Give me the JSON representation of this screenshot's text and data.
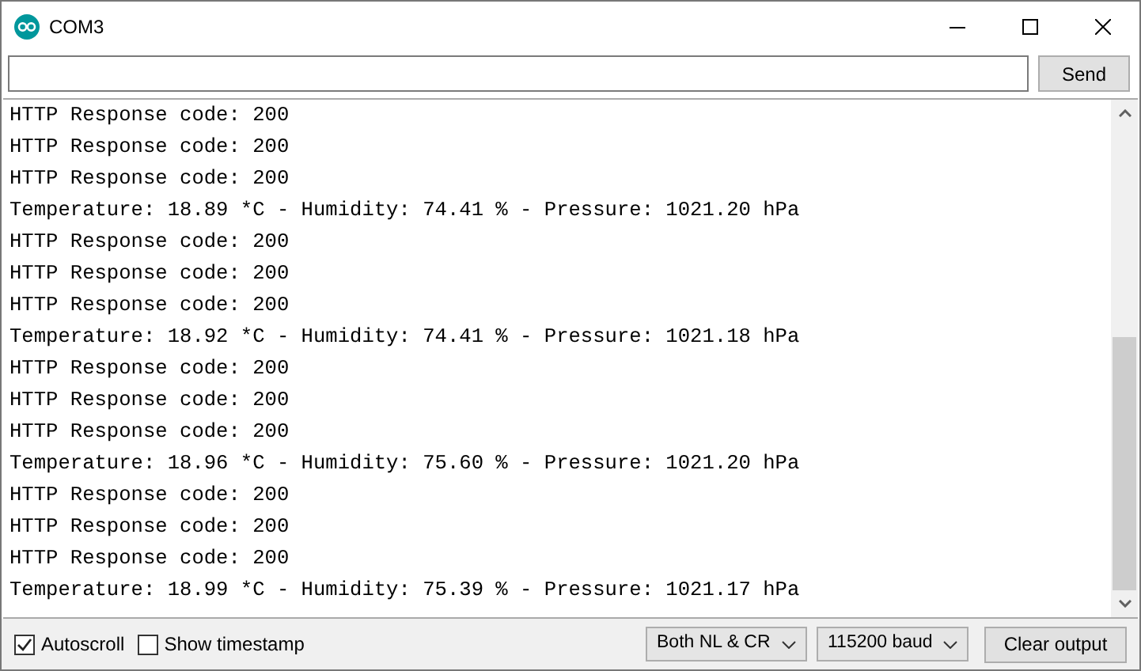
{
  "window": {
    "title": "COM3"
  },
  "send_button": "Send",
  "output_lines": [
    "HTTP Response code: 200",
    "HTTP Response code: 200",
    "HTTP Response code: 200",
    "Temperature: 18.89 *C - Humidity: 74.41 % - Pressure: 1021.20 hPa",
    "HTTP Response code: 200",
    "HTTP Response code: 200",
    "HTTP Response code: 200",
    "Temperature: 18.92 *C - Humidity: 74.41 % - Pressure: 1021.18 hPa",
    "HTTP Response code: 200",
    "HTTP Response code: 200",
    "HTTP Response code: 200",
    "Temperature: 18.96 *C - Humidity: 75.60 % - Pressure: 1021.20 hPa",
    "HTTP Response code: 200",
    "HTTP Response code: 200",
    "HTTP Response code: 200",
    "Temperature: 18.99 *C - Humidity: 75.39 % - Pressure: 1021.17 hPa"
  ],
  "options": [
    {
      "label": "Autoscroll",
      "checked": true
    },
    {
      "label": "Show timestamp",
      "checked": false
    }
  ],
  "selects": [
    {
      "value": "Both NL & CR"
    },
    {
      "value": "115200 baud"
    }
  ],
  "clear_button": "Clear output"
}
